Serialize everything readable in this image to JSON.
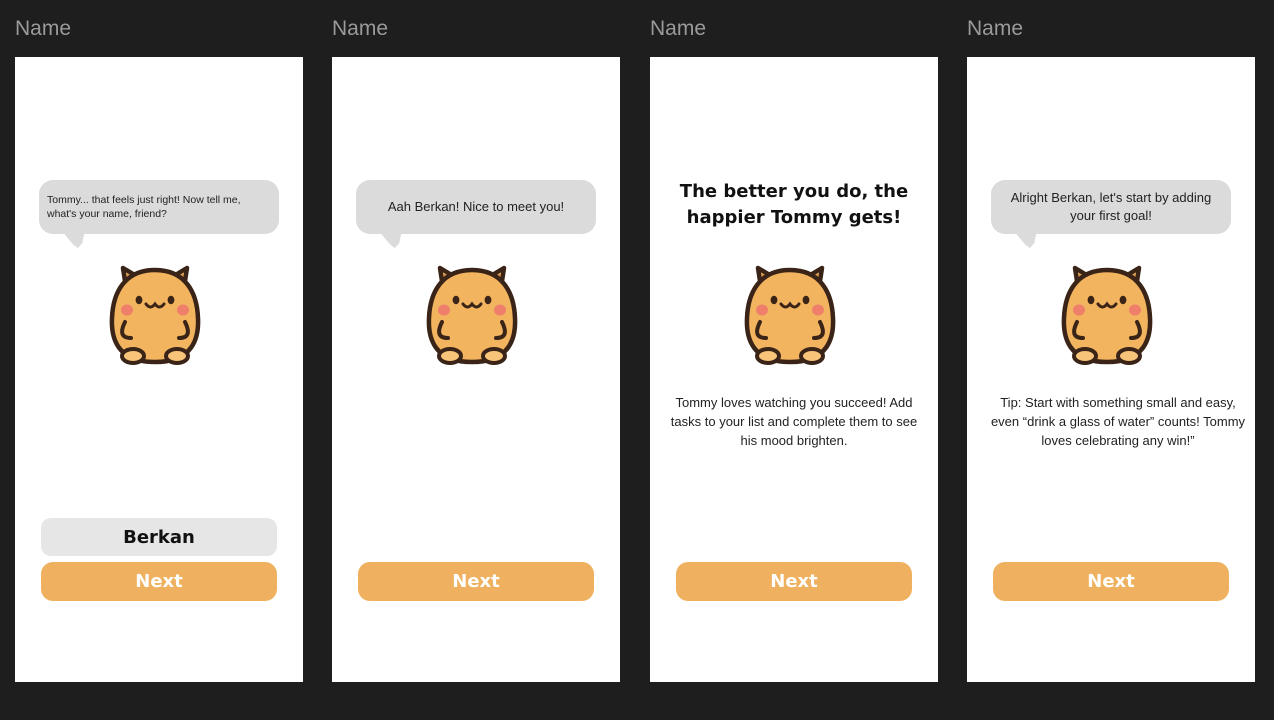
{
  "frames": [
    {
      "label": "Name",
      "bubble": "Tommy... that feels just right! Now tell me, what's your name, friend?",
      "name_value": "Berkan",
      "next_label": "Next"
    },
    {
      "label": "Name",
      "bubble": "Aah Berkan! Nice to meet you!",
      "next_label": "Next"
    },
    {
      "label": "Name",
      "headline_line1": "The better you do, the",
      "headline_line2": "happier Tommy gets!",
      "paragraph": "Tommy loves watching you succeed! Add tasks to your list and complete them to see his mood brighten.",
      "next_label": "Next"
    },
    {
      "label": "Name",
      "bubble": "Alright Berkan, let's start by adding your first goal!",
      "paragraph": "Tip: Start with something small and easy, even “drink a glass of water” counts! Tommy loves celebrating any win!”",
      "next_label": "Next"
    }
  ],
  "colors": {
    "canvas": "#1e1e1e",
    "frame": "#ffffff",
    "bubble": "#dbdbdb",
    "button": "#efb15f",
    "mascot_body": "#f3b45f",
    "mascot_outline": "#3a2418",
    "mascot_cheek": "#ef7f6a"
  },
  "icons": {
    "mascot": "hamster-mascot-icon"
  }
}
